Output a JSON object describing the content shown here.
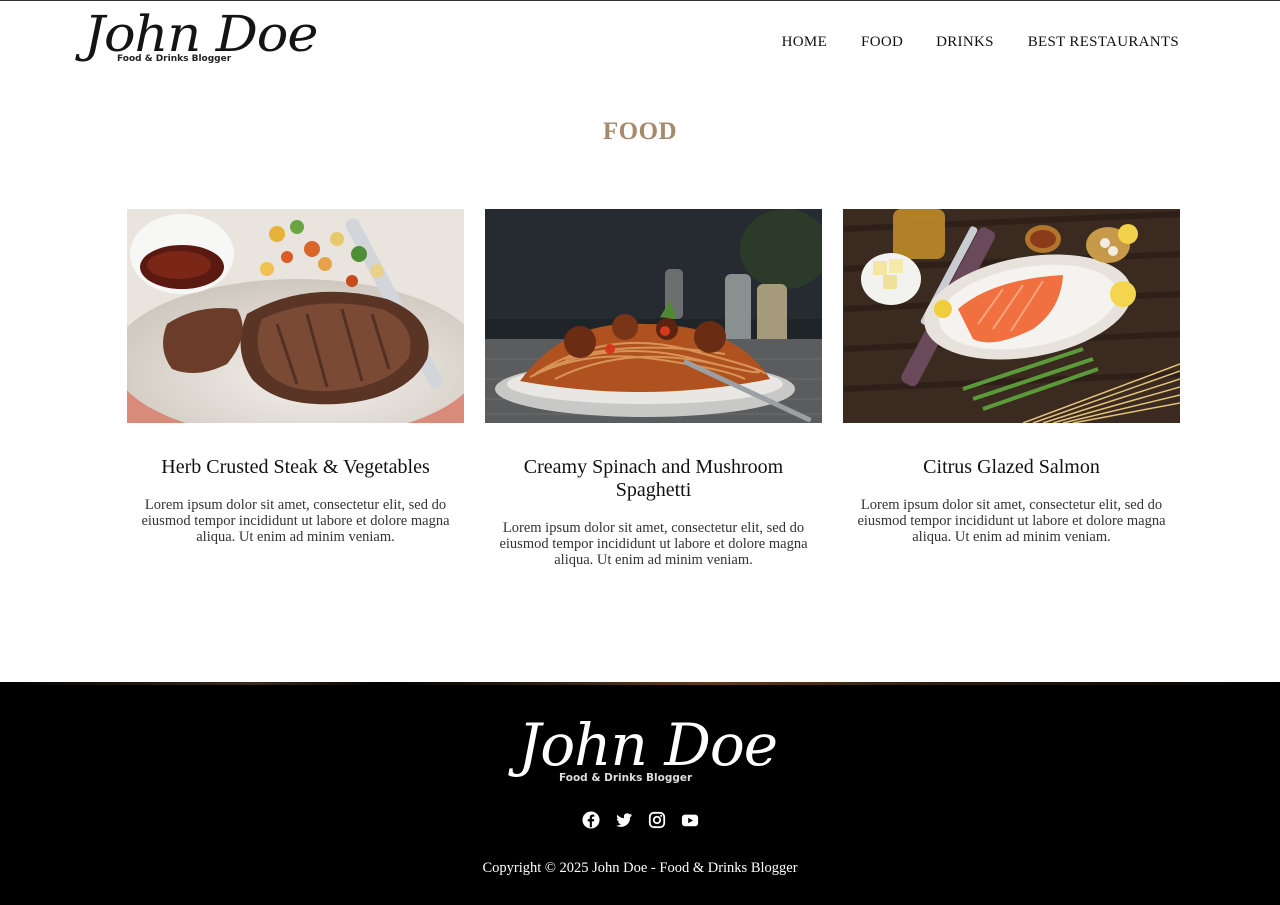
{
  "brand": {
    "name": "John Doe",
    "tagline": "Food & Drinks Blogger"
  },
  "nav": {
    "items": [
      "HOME",
      "FOOD",
      "DRINKS",
      "BEST RESTAURANTS"
    ]
  },
  "page": {
    "title": "FOOD"
  },
  "posts": [
    {
      "title": "Herb Crusted Steak & Vegetables",
      "excerpt": "Lorem ipsum dolor sit amet, consectetur elit, sed do eiusmod tempor incididunt ut labore et dolore magna aliqua. Ut enim ad minim veniam."
    },
    {
      "title": "Creamy Spinach and Mushroom Spaghetti",
      "excerpt": "Lorem ipsum dolor sit amet, consectetur elit, sed do eiusmod tempor incididunt ut labore et dolore magna aliqua. Ut enim ad minim veniam."
    },
    {
      "title": "Citrus Glazed Salmon",
      "excerpt": "Lorem ipsum dolor sit amet, consectetur elit, sed do eiusmod tempor incididunt ut labore et dolore magna aliqua. Ut enim ad minim veniam."
    }
  ],
  "footer": {
    "social_icons": [
      "facebook-icon",
      "twitter-icon",
      "instagram-icon",
      "youtube-icon"
    ],
    "copyright": "Copyright © 2025 John Doe - Food & Drinks Blogger"
  },
  "colors": {
    "accent": "#a58a6d",
    "footer_bg": "#000000"
  }
}
